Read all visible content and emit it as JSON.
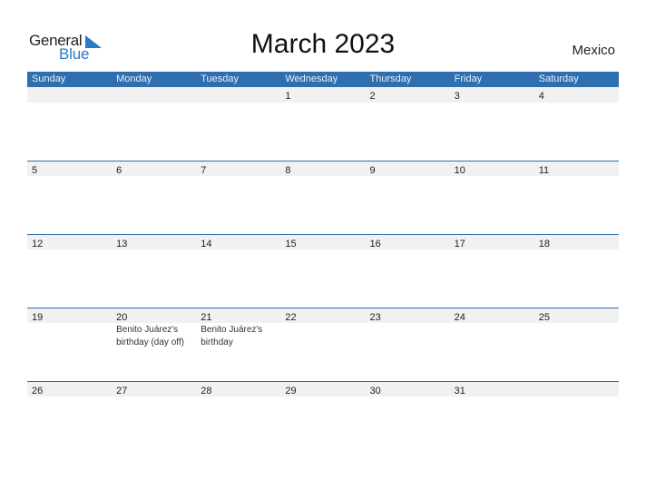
{
  "logo": {
    "line1": "General",
    "line2": "Blue",
    "accent": "#2a7bc8"
  },
  "title": "March 2023",
  "country": "Mexico",
  "colors": {
    "header_bg": "#2f6fb0",
    "date_bar_bg": "#f1f1f1"
  },
  "weekdays": [
    "Sunday",
    "Monday",
    "Tuesday",
    "Wednesday",
    "Thursday",
    "Friday",
    "Saturday"
  ],
  "weeks": [
    {
      "days": [
        "",
        "",
        "",
        "1",
        "2",
        "3",
        "4"
      ],
      "events": [
        "",
        "",
        "",
        "",
        "",
        "",
        ""
      ]
    },
    {
      "days": [
        "5",
        "6",
        "7",
        "8",
        "9",
        "10",
        "11"
      ],
      "events": [
        "",
        "",
        "",
        "",
        "",
        "",
        ""
      ]
    },
    {
      "days": [
        "12",
        "13",
        "14",
        "15",
        "16",
        "17",
        "18"
      ],
      "events": [
        "",
        "",
        "",
        "",
        "",
        "",
        ""
      ]
    },
    {
      "days": [
        "19",
        "20",
        "21",
        "22",
        "23",
        "24",
        "25"
      ],
      "events": [
        "",
        "Benito Juárez's birthday (day off)",
        "Benito Juárez's birthday",
        "",
        "",
        "",
        ""
      ]
    },
    {
      "days": [
        "26",
        "27",
        "28",
        "29",
        "30",
        "31",
        ""
      ],
      "events": [
        "",
        "",
        "",
        "",
        "",
        "",
        ""
      ]
    }
  ]
}
